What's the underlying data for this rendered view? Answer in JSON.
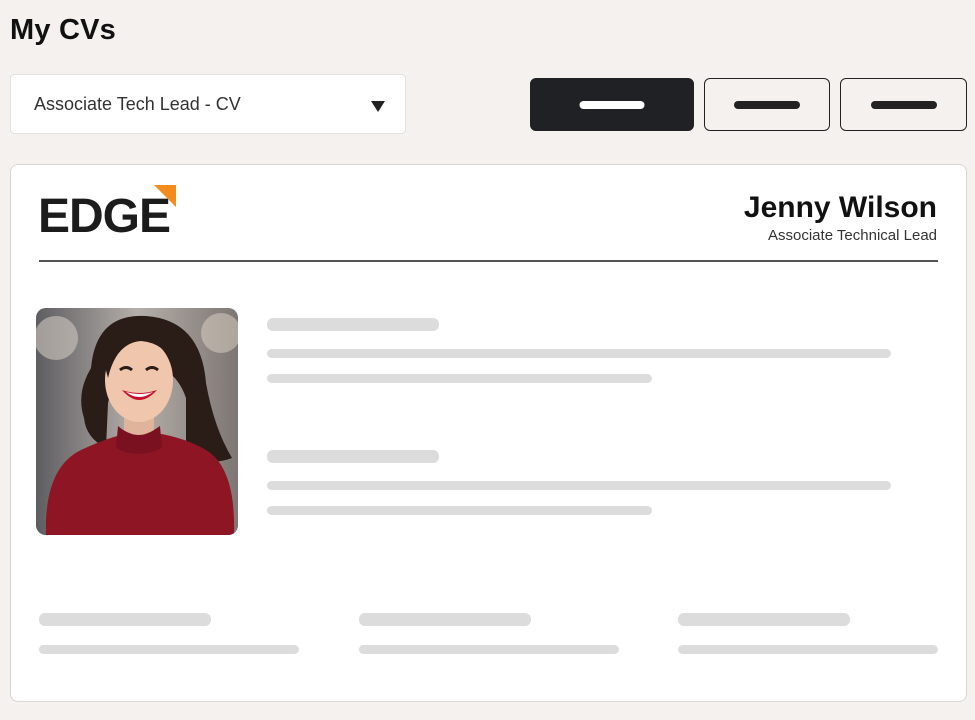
{
  "page": {
    "title": "My CVs"
  },
  "cv_selector": {
    "selected": "Associate Tech Lead - CV",
    "icon": "chevron-down-icon"
  },
  "actions": [
    {
      "name": "primary-action",
      "style": "dark"
    },
    {
      "name": "secondary-action",
      "style": "outline"
    },
    {
      "name": "tertiary-action",
      "style": "outline"
    }
  ],
  "cv": {
    "logo": {
      "text": "EDGE",
      "accent_color": "#f28c1f"
    },
    "person": {
      "name": "Jenny Wilson",
      "role": "Associate Technical Lead"
    },
    "photo_description_icon": "profile-photo"
  },
  "colors": {
    "background": "#f4f1ee",
    "primary_button": "#1f2125",
    "placeholder": "#dcdcdc",
    "logo_accent": "#f28c1f"
  }
}
